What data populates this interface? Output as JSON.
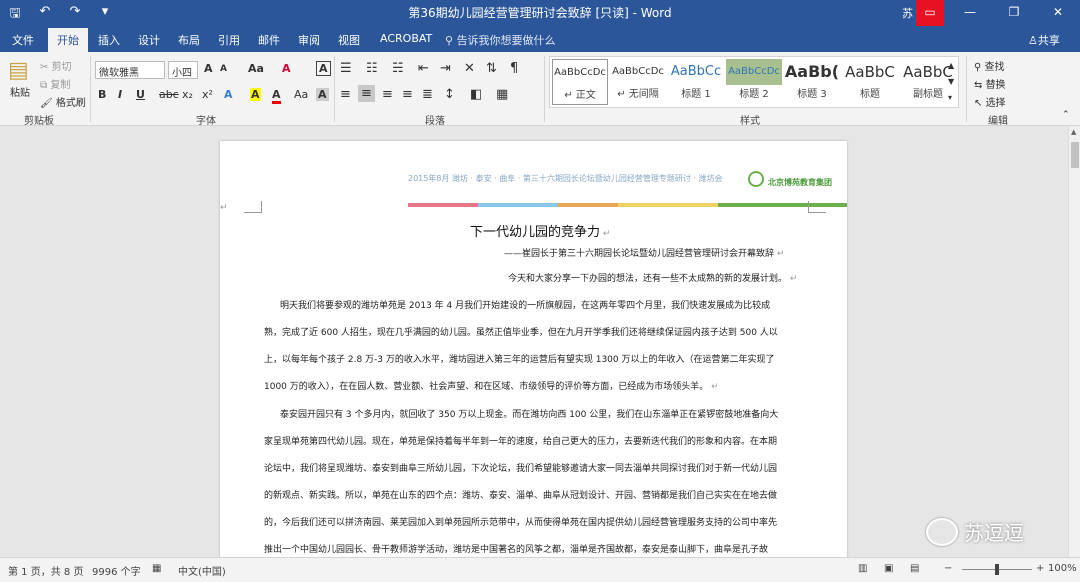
{
  "titlebar": {
    "qat": [
      "🖫",
      "↶",
      "↷",
      "▾"
    ],
    "title": "第36期幼儿园经营管理研讨会致辞 [只读] - Word",
    "user": "苏 超",
    "controls": [
      "▭",
      "—",
      "❐",
      "✕"
    ]
  },
  "tabs": [
    "文件",
    "开始",
    "插入",
    "设计",
    "布局",
    "引用",
    "邮件",
    "审阅",
    "视图",
    "ACROBAT"
  ],
  "tellme": "告诉我你想要做什么",
  "share": "共享",
  "clipboard": {
    "paste": "粘贴",
    "cut": "剪切",
    "copy": "复制",
    "format_painter": "格式刷",
    "label": "剪贴板"
  },
  "font": {
    "name": "微软雅黑",
    "size": "小四",
    "label": "字体",
    "row1": [
      "A",
      "A",
      "Aa",
      "A",
      "A"
    ],
    "row2": [
      "B",
      "I",
      "U",
      "abc",
      "x₂",
      "x²",
      "A",
      "A",
      "A",
      "Aa",
      "A",
      "A"
    ]
  },
  "paragraph": {
    "label": "段落"
  },
  "styles": {
    "label": "样式",
    "items": [
      {
        "sample": "AaBbCcDc",
        "name": "↵ 正文"
      },
      {
        "sample": "AaBbCcDc",
        "name": "↵ 无间隔"
      },
      {
        "sample": "AaBbCc",
        "name": "标题 1"
      },
      {
        "sample": "AaBbCcDc",
        "name": "标题 2"
      },
      {
        "sample": "AaBb(",
        "name": "标题 3"
      },
      {
        "sample": "AaBbC",
        "name": "标题"
      },
      {
        "sample": "AaBbC",
        "name": "副标题"
      }
    ]
  },
  "editing": {
    "find": "查找",
    "replace": "替换",
    "select": "选择",
    "label": "编辑"
  },
  "document": {
    "banner_text": "2015年8月 潍坊 · 泰安 · 曲阜 · 第三十六期园长论坛暨幼儿园经营管理专题研讨 · 潍坊会",
    "banner_logo": "北京博苑教育集团",
    "title": "下一代幼儿园的竞争力",
    "subtitle": "——崔园长于第三十六期园长论坛暨幼儿园经营管理研讨会开幕致辞",
    "line_intro": "今天和大家分享一下办园的想法，还有一些不太成熟的新的发展计划。",
    "para1": [
      "明天我们将要参观的潍坊单苑是 2013 年 4 月我们开始建设的一所旗舰园，在这两年零四个月里，我们快速发展成为比较成",
      "熟，完成了近 600 人招生，现在几乎满园的幼儿园。虽然正值毕业季，但在九月开学季我们还将继续保证园内孩子达到 500 人以",
      "上，以每年每个孩子 2.8 万-3 万的收入水平，潍坊园进入第三年的运营后有望实现 1300 万以上的年收入（在运营第二年实现了",
      "1000 万的收入），在在园人数、营业额、社会声望、和在区域、市级领导的评价等方面，已经成为市场领头羊。"
    ],
    "para2": [
      "泰安园开园只有 3 个多月内，就回收了 350 万以上现金。而在潍坊向西 100 公里，我们在山东淄单正在紧锣密鼓地准备向大",
      "家呈现单苑第四代幼儿园。现在，单苑是保持着每半年到一年的速度，给自己更大的压力，去要新迭代我们的形象和内容。在本期",
      "论坛中，我们将呈现潍坊、泰安到曲阜三所幼儿园，下次论坛，我们希望能够邀请大家一同去淄单共同探讨我们对于新一代幼儿园",
      "的新观点、新实践。所以，单苑在山东的四个点：潍坊、泰安、淄单、曲阜从冠划设计、开园、营销都是我们自己实实在在地去做",
      "的，今后我们还可以拼济南园、莱芜园加入到单苑园所示范带中，从而使得单苑在国内提供幼儿园经营管理服务支持的公司中率先",
      "推出一个中国幼儿园园长、骨干教师游学活动，潍坊是中国著名的风筝之都，淄单是齐国故都，泰安是泰山脚下，曲阜是孔子故"
    ]
  },
  "status": {
    "page": "第 1 页，共 8 页",
    "words": "9996 个字",
    "lang": "中文(中国)",
    "zoom": "100%"
  },
  "watermark": "苏逗逗",
  "colors": {
    "accent": "#2b579a",
    "close_red": "#e81123"
  }
}
